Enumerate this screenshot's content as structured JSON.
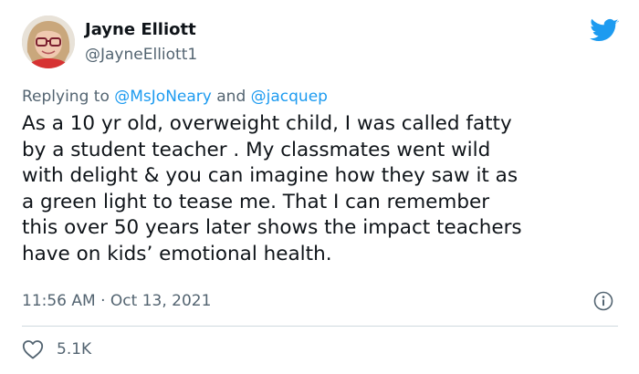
{
  "user": {
    "display_name": "Jayne Elliott",
    "handle": "@JayneElliott1"
  },
  "reply": {
    "prefix": "Replying to ",
    "mention1": "@MsJoNeary",
    "connector": " and ",
    "mention2": "@jacquep"
  },
  "tweet": {
    "lines": [
      "As a 10 yr old, overweight child, I was called fatty",
      "by a student teacher . My classmates went wild",
      "with delight & you can imagine how they saw it as",
      "a green light to tease me. That I can remember",
      "this over 50 years later shows the impact teachers",
      "have on kids’ emotional health."
    ],
    "timestamp": "11:56 AM · Oct 13, 2021"
  },
  "stats": {
    "likes": "5.1K"
  },
  "icons": {
    "brand": "twitter-bird-icon",
    "info": "info-icon",
    "like": "heart-icon"
  },
  "colors": {
    "brand_blue": "#1d9bf0",
    "secondary_text": "#536471",
    "primary_text": "#0f1419",
    "divider": "#cfd9de"
  }
}
